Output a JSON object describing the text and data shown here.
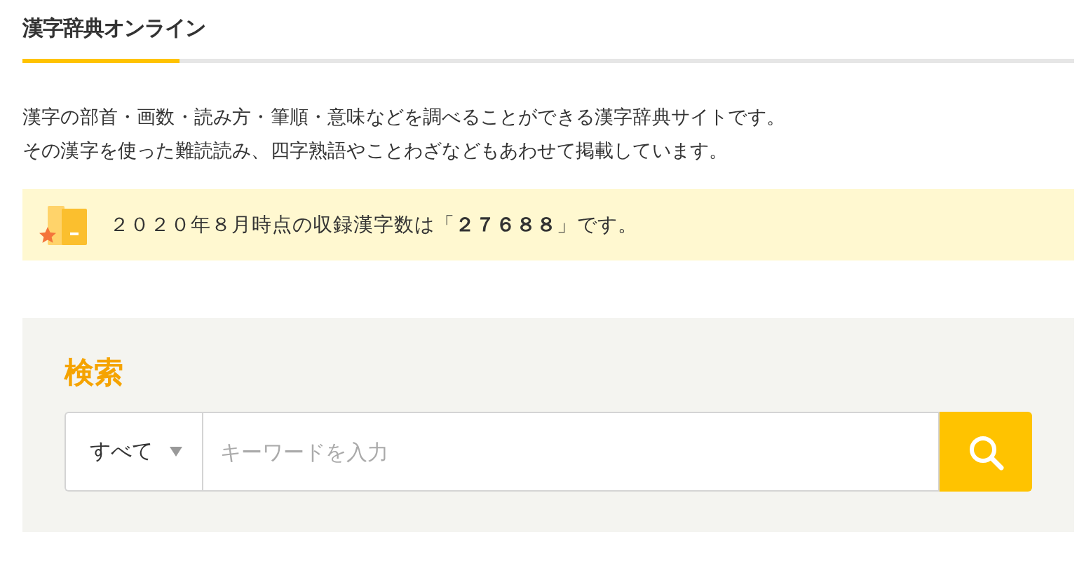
{
  "header": {
    "title": "漢字辞典オンライン"
  },
  "intro": [
    "漢字の部首・画数・読み方・筆順・意味などを調べることができる漢字辞典サイトです。",
    "その漢字を使った難読読み、四字熟語やことわざなどもあわせて掲載しています。"
  ],
  "notice": {
    "text": "２０２０年８月時点の収録漢字数は「**２７６８８**」です。"
  },
  "search": {
    "heading": "検索",
    "category": "すべて",
    "placeholder": "キーワードを入力"
  }
}
